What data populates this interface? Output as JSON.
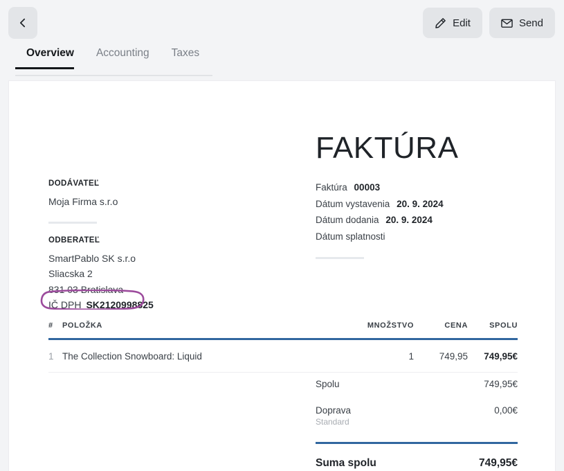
{
  "toolbar": {
    "back_icon": "chevron-left-icon",
    "edit_label": "Edit",
    "edit_icon": "pencil-icon",
    "send_label": "Send",
    "send_icon": "envelope-icon"
  },
  "tabs": [
    {
      "label": "Overview",
      "active": true
    },
    {
      "label": "Accounting",
      "active": false
    },
    {
      "label": "Taxes",
      "active": false
    }
  ],
  "document": {
    "title": "FAKTÚRA",
    "supplier": {
      "label": "DODÁVATEĽ",
      "lines": [
        "Moja Firma s.r.o"
      ]
    },
    "customer": {
      "label": "ODBERATEĽ",
      "lines": [
        "SmartPablo SK s.r.o",
        "Sliacska 2",
        "831 03 Bratislava"
      ],
      "vat_label": "IČ DPH",
      "vat_value": "SK2120998825"
    },
    "meta": [
      {
        "label": "Faktúra",
        "value": "00003"
      },
      {
        "label": "Dátum vystavenia",
        "value": "20. 9. 2024"
      },
      {
        "label": "Dátum dodania",
        "value": "20. 9. 2024"
      },
      {
        "label": "Dátum splatnosti",
        "value": ""
      }
    ],
    "items": {
      "headers": {
        "num": "#",
        "item": "POLOŽKA",
        "qty": "MNOŽSTVO",
        "price": "CENA",
        "total": "SPOLU"
      },
      "rows": [
        {
          "num": "1",
          "item": "The Collection Snowboard: Liquid",
          "qty": "1",
          "price": "749,95",
          "total": "749,95€"
        }
      ]
    },
    "totals": {
      "subtotal_label": "Spolu",
      "subtotal_value": "749,95€",
      "shipping_label": "Doprava",
      "shipping_value": "0,00€",
      "shipping_note": "Standard",
      "grand_label": "Suma spolu",
      "grand_value": "749,95€"
    }
  },
  "annotation": {
    "type": "hand-drawn-ellipse",
    "color": "#9c4b9c",
    "target": "IČ DPH SK2120998825"
  },
  "colors": {
    "page_background": "#f3f4f6",
    "card_background": "#ffffff",
    "accent_rule": "#31679f",
    "button_background": "#e3e5e8",
    "annotation": "#9c4b9c"
  }
}
